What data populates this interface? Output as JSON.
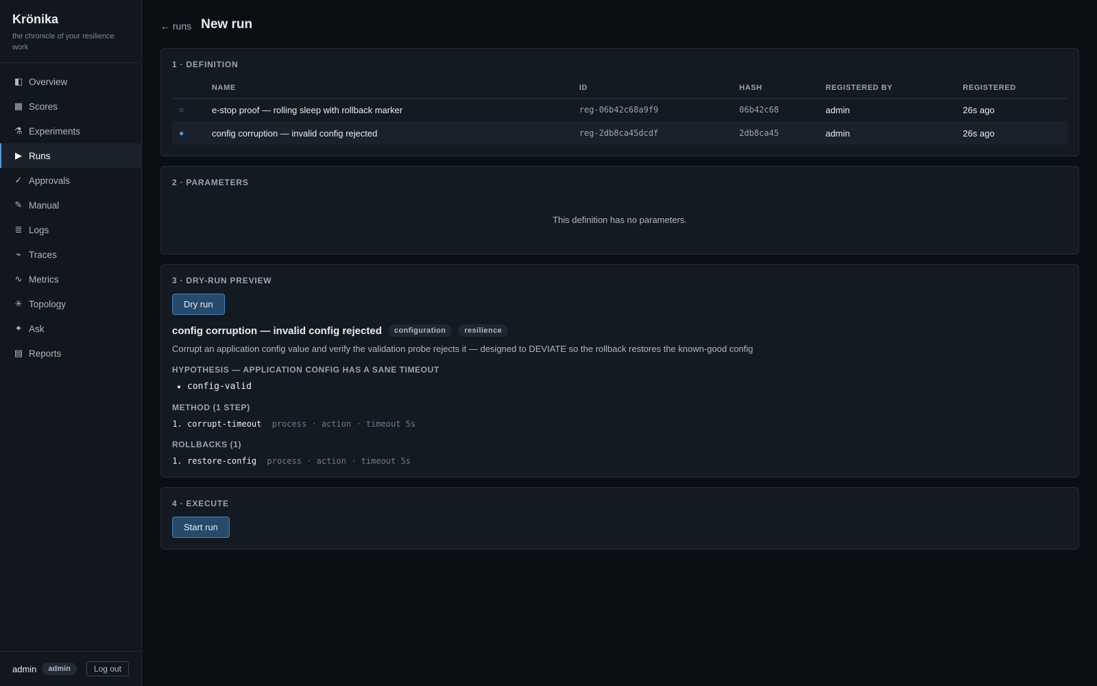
{
  "app": {
    "name": "Krönika",
    "tagline": "the chronicle of your resilience work"
  },
  "sidebar": {
    "items": [
      {
        "icon": "overview-icon",
        "glyph": "◧",
        "label": "Overview"
      },
      {
        "icon": "scores-icon",
        "glyph": "▦",
        "label": "Scores"
      },
      {
        "icon": "flask-icon",
        "glyph": "⚗",
        "label": "Experiments"
      },
      {
        "icon": "play-icon",
        "glyph": "▶",
        "label": "Runs",
        "active": true
      },
      {
        "icon": "check-icon",
        "glyph": "✓",
        "label": "Approvals"
      },
      {
        "icon": "pencil-icon",
        "glyph": "✎",
        "label": "Manual"
      },
      {
        "icon": "logs-icon",
        "glyph": "≣",
        "label": "Logs"
      },
      {
        "icon": "traces-icon",
        "glyph": "⌁",
        "label": "Traces"
      },
      {
        "icon": "metrics-icon",
        "glyph": "∿",
        "label": "Metrics"
      },
      {
        "icon": "topology-icon",
        "glyph": "✳",
        "label": "Topology"
      },
      {
        "icon": "sparkle-icon",
        "glyph": "✦",
        "label": "Ask"
      },
      {
        "icon": "reports-icon",
        "glyph": "▤",
        "label": "Reports"
      }
    ],
    "footer": {
      "user": "admin",
      "role_badge": "admin",
      "logout_label": "Log out"
    }
  },
  "header": {
    "back_arrow": "←",
    "back_label": "runs",
    "title": "New run"
  },
  "definition": {
    "section_title": "1 · DEFINITION",
    "columns": [
      "NAME",
      "ID",
      "HASH",
      "REGISTERED BY",
      "REGISTERED"
    ],
    "rows": [
      {
        "radio": "○",
        "name": "e-stop proof — rolling sleep with rollback marker",
        "id": "reg-06b42c68a9f9",
        "hash": "06b42c68",
        "registered_by": "admin",
        "registered": "26s ago",
        "selected": false
      },
      {
        "radio": "●",
        "name": "config corruption — invalid config rejected",
        "id": "reg-2db8ca45dcdf",
        "hash": "2db8ca45",
        "registered_by": "admin",
        "registered": "26s ago",
        "selected": true
      }
    ]
  },
  "parameters": {
    "section_title": "2 · PARAMETERS",
    "empty_text": "This definition has no parameters."
  },
  "dry_run": {
    "section_title": "3 · DRY-RUN PREVIEW",
    "button_label": "Dry run",
    "title": "config corruption — invalid config rejected",
    "tags": [
      "configuration",
      "resilience"
    ],
    "description": "Corrupt an application config value and verify the validation probe rejects it — designed to DEVIATE so the rollback restores the known-good config",
    "hypothesis_title": "HYPOTHESIS — APPLICATION CONFIG HAS A SANE TIMEOUT",
    "hypothesis_items": [
      "config-valid"
    ],
    "method_title": "METHOD (1 STEP)",
    "method_steps": [
      {
        "name": "corrupt-timeout",
        "meta": "process · action · timeout 5s"
      }
    ],
    "rollbacks_title": "ROLLBACKS (1)",
    "rollback_steps": [
      {
        "name": "restore-config",
        "meta": "process · action · timeout 5s"
      }
    ]
  },
  "execute": {
    "section_title": "4 · EXECUTE",
    "button_label": "Start run"
  },
  "colors": {
    "accent": "#4a9eda",
    "background": "#0b0f14",
    "card": "#141a21",
    "button": "#27496b"
  }
}
